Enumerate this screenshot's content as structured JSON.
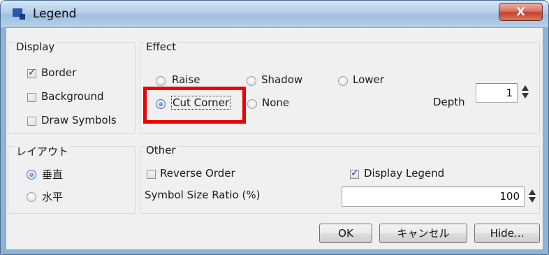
{
  "window": {
    "title": "Legend",
    "close_label": "X"
  },
  "display": {
    "title": "Display",
    "border": {
      "label": "Border",
      "checked": true
    },
    "background": {
      "label": "Background",
      "checked": false
    },
    "draw_symbols": {
      "label": "Draw Symbols",
      "checked": false
    }
  },
  "effect": {
    "title": "Effect",
    "options": [
      "Raise",
      "Shadow",
      "Lower",
      "Cut Corner",
      "None"
    ],
    "selected": "Cut Corner",
    "depth_label": "Depth",
    "depth_value": "1"
  },
  "layout": {
    "title": "レイアウト",
    "options": [
      "垂直",
      "水平"
    ],
    "selected": "垂直"
  },
  "other": {
    "title": "Other",
    "reverse_order": {
      "label": "Reverse Order",
      "checked": false
    },
    "display_legend": {
      "label": "Display Legend",
      "checked": true
    },
    "symbol_size_label": "Symbol Size Ratio (%)",
    "symbol_size_value": "100"
  },
  "buttons": {
    "ok": "OK",
    "cancel": "キャンセル",
    "hide": "Hide..."
  },
  "colors": {
    "highlight": "#ee0000",
    "titlebar": "#b3cde8",
    "close": "#c4402a"
  }
}
